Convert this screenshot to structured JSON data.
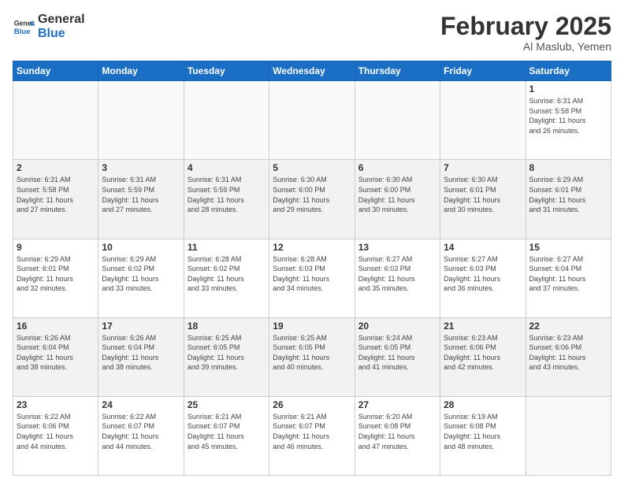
{
  "header": {
    "logo_line1": "General",
    "logo_line2": "Blue",
    "title": "February 2025",
    "subtitle": "Al Maslub, Yemen"
  },
  "days_of_week": [
    "Sunday",
    "Monday",
    "Tuesday",
    "Wednesday",
    "Thursday",
    "Friday",
    "Saturday"
  ],
  "weeks": [
    [
      {
        "num": "",
        "info": ""
      },
      {
        "num": "",
        "info": ""
      },
      {
        "num": "",
        "info": ""
      },
      {
        "num": "",
        "info": ""
      },
      {
        "num": "",
        "info": ""
      },
      {
        "num": "",
        "info": ""
      },
      {
        "num": "1",
        "info": "Sunrise: 6:31 AM\nSunset: 5:58 PM\nDaylight: 11 hours\nand 26 minutes."
      }
    ],
    [
      {
        "num": "2",
        "info": "Sunrise: 6:31 AM\nSunset: 5:58 PM\nDaylight: 11 hours\nand 27 minutes."
      },
      {
        "num": "3",
        "info": "Sunrise: 6:31 AM\nSunset: 5:59 PM\nDaylight: 11 hours\nand 27 minutes."
      },
      {
        "num": "4",
        "info": "Sunrise: 6:31 AM\nSunset: 5:59 PM\nDaylight: 11 hours\nand 28 minutes."
      },
      {
        "num": "5",
        "info": "Sunrise: 6:30 AM\nSunset: 6:00 PM\nDaylight: 11 hours\nand 29 minutes."
      },
      {
        "num": "6",
        "info": "Sunrise: 6:30 AM\nSunset: 6:00 PM\nDaylight: 11 hours\nand 30 minutes."
      },
      {
        "num": "7",
        "info": "Sunrise: 6:30 AM\nSunset: 6:01 PM\nDaylight: 11 hours\nand 30 minutes."
      },
      {
        "num": "8",
        "info": "Sunrise: 6:29 AM\nSunset: 6:01 PM\nDaylight: 11 hours\nand 31 minutes."
      }
    ],
    [
      {
        "num": "9",
        "info": "Sunrise: 6:29 AM\nSunset: 6:01 PM\nDaylight: 11 hours\nand 32 minutes."
      },
      {
        "num": "10",
        "info": "Sunrise: 6:29 AM\nSunset: 6:02 PM\nDaylight: 11 hours\nand 33 minutes."
      },
      {
        "num": "11",
        "info": "Sunrise: 6:28 AM\nSunset: 6:02 PM\nDaylight: 11 hours\nand 33 minutes."
      },
      {
        "num": "12",
        "info": "Sunrise: 6:28 AM\nSunset: 6:03 PM\nDaylight: 11 hours\nand 34 minutes."
      },
      {
        "num": "13",
        "info": "Sunrise: 6:27 AM\nSunset: 6:03 PM\nDaylight: 11 hours\nand 35 minutes."
      },
      {
        "num": "14",
        "info": "Sunrise: 6:27 AM\nSunset: 6:03 PM\nDaylight: 11 hours\nand 36 minutes."
      },
      {
        "num": "15",
        "info": "Sunrise: 6:27 AM\nSunset: 6:04 PM\nDaylight: 11 hours\nand 37 minutes."
      }
    ],
    [
      {
        "num": "16",
        "info": "Sunrise: 6:26 AM\nSunset: 6:04 PM\nDaylight: 11 hours\nand 38 minutes."
      },
      {
        "num": "17",
        "info": "Sunrise: 6:26 AM\nSunset: 6:04 PM\nDaylight: 11 hours\nand 38 minutes."
      },
      {
        "num": "18",
        "info": "Sunrise: 6:25 AM\nSunset: 6:05 PM\nDaylight: 11 hours\nand 39 minutes."
      },
      {
        "num": "19",
        "info": "Sunrise: 6:25 AM\nSunset: 6:05 PM\nDaylight: 11 hours\nand 40 minutes."
      },
      {
        "num": "20",
        "info": "Sunrise: 6:24 AM\nSunset: 6:05 PM\nDaylight: 11 hours\nand 41 minutes."
      },
      {
        "num": "21",
        "info": "Sunrise: 6:23 AM\nSunset: 6:06 PM\nDaylight: 11 hours\nand 42 minutes."
      },
      {
        "num": "22",
        "info": "Sunrise: 6:23 AM\nSunset: 6:06 PM\nDaylight: 11 hours\nand 43 minutes."
      }
    ],
    [
      {
        "num": "23",
        "info": "Sunrise: 6:22 AM\nSunset: 6:06 PM\nDaylight: 11 hours\nand 44 minutes."
      },
      {
        "num": "24",
        "info": "Sunrise: 6:22 AM\nSunset: 6:07 PM\nDaylight: 11 hours\nand 44 minutes."
      },
      {
        "num": "25",
        "info": "Sunrise: 6:21 AM\nSunset: 6:07 PM\nDaylight: 11 hours\nand 45 minutes."
      },
      {
        "num": "26",
        "info": "Sunrise: 6:21 AM\nSunset: 6:07 PM\nDaylight: 11 hours\nand 46 minutes."
      },
      {
        "num": "27",
        "info": "Sunrise: 6:20 AM\nSunset: 6:08 PM\nDaylight: 11 hours\nand 47 minutes."
      },
      {
        "num": "28",
        "info": "Sunrise: 6:19 AM\nSunset: 6:08 PM\nDaylight: 11 hours\nand 48 minutes."
      },
      {
        "num": "",
        "info": ""
      }
    ]
  ]
}
